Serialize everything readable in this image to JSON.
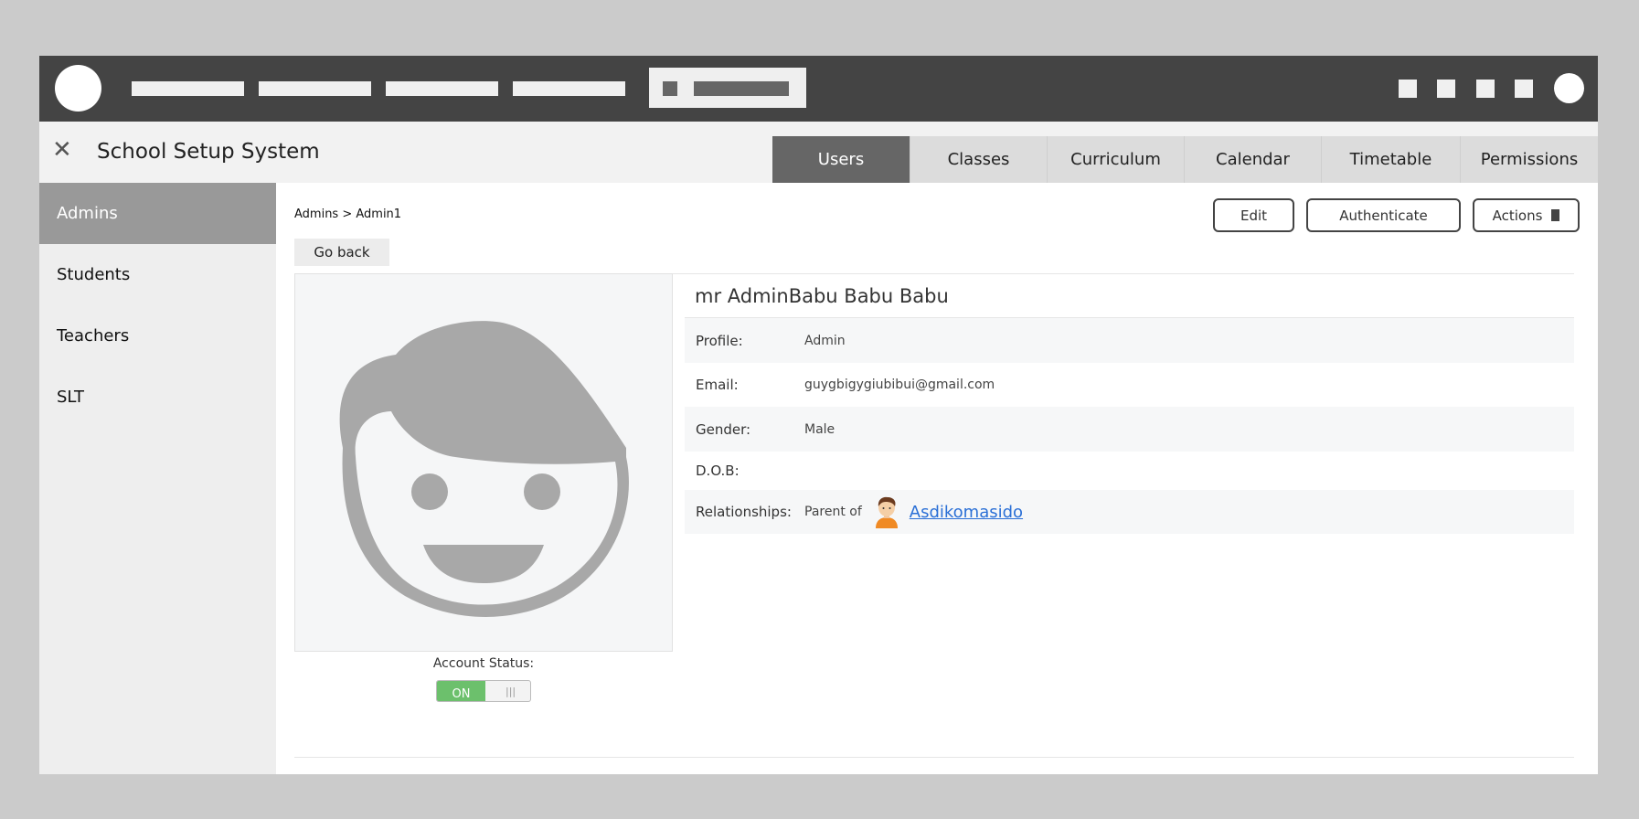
{
  "app": {
    "title": "School Setup System"
  },
  "tabs": [
    "Users",
    "Classes",
    "Curriculum",
    "Calendar",
    "Timetable",
    "Permissions"
  ],
  "sidebar": {
    "items": [
      "Admins",
      "Students",
      "Teachers",
      "SLT"
    ]
  },
  "breadcrumb": "Admins > Admin1",
  "buttons": {
    "edit": "Edit",
    "authenticate": "Authenticate",
    "actions": "Actions",
    "go_back": "Go back"
  },
  "profile": {
    "name": "mr AdminBabu Babu Babu",
    "fields": {
      "profile": {
        "label": "Profile:",
        "value": "Admin"
      },
      "email": {
        "label": "Email:",
        "value": "guygbigygiubibui@gmail.com"
      },
      "gender": {
        "label": "Gender:",
        "value": "Male"
      },
      "dob": {
        "label": "D.O.B:",
        "value": ""
      },
      "relationships": {
        "label": "Relationships:",
        "prefix": "Parent of",
        "link": "Asdikomasido"
      }
    },
    "account_status": {
      "label": "Account Status:",
      "toggle": "ON"
    }
  },
  "colors": {
    "topbar": "#444444",
    "active_tab": "#666666",
    "sidebar_active": "#999999",
    "toggle_on": "#6cc06c",
    "link": "#2a6fd6"
  },
  "icons": {
    "close": "close-icon",
    "avatar": "user-avatar-icon",
    "relation_avatar": "child-avatar-icon"
  }
}
